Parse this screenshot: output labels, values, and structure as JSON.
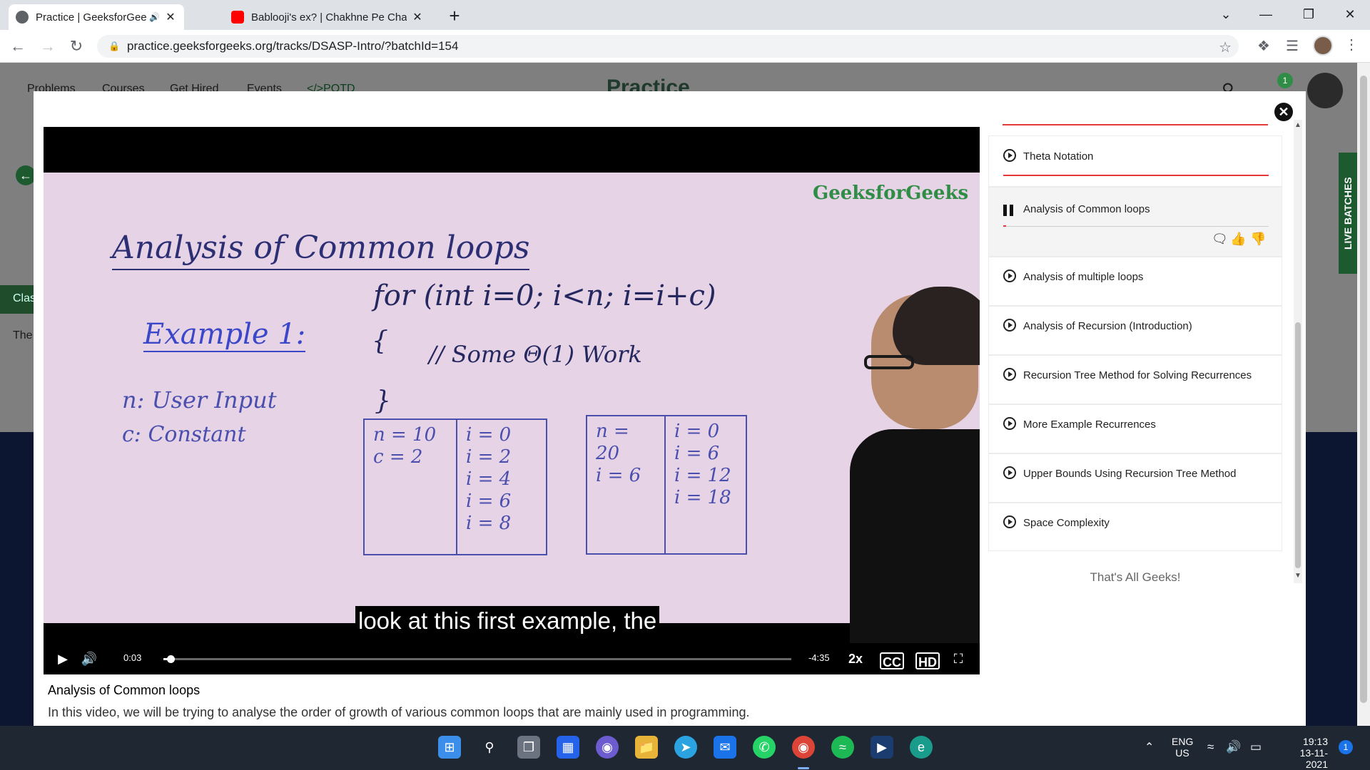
{
  "browser": {
    "tabs": [
      {
        "title": "Practice | GeeksforGeeks | A",
        "active": true
      },
      {
        "title": "Bablooji's ex? | Chakhne Pe Charc",
        "active": false
      }
    ],
    "new_tab_label": "+",
    "url": "practice.geeksforgeeks.org/tracks/DSASP-Intro/?batchId=154"
  },
  "site": {
    "nav": [
      "Problems",
      "Courses",
      "Get Hired",
      "Events",
      "</>POTD"
    ],
    "logo": "Practice",
    "notification_count": "1",
    "background_labels": [
      "Clas",
      "The"
    ],
    "live_batches": "LIVE BATCHES"
  },
  "video": {
    "board": {
      "title": "Analysis of Common loops",
      "example": "Example 1:",
      "n_line": "n: User Input",
      "c_line": "c: Constant",
      "for_line": "for (int i=0; i<n; i=i+c)",
      "brace_open": "{",
      "work": "// Some Θ(1) Work",
      "brace_close": "}",
      "table1": {
        "left": [
          "n = 10",
          "c = 2"
        ],
        "right": [
          "i = 0",
          "i = 2",
          "i = 4",
          "i = 6",
          "i = 8"
        ]
      },
      "table2": {
        "left": [
          "n = 20",
          "i = 6"
        ],
        "right": [
          "i = 0",
          "i = 6",
          "i = 12",
          "i = 18"
        ]
      },
      "watermark": "GeeksforGeeks"
    },
    "caption": "look at this first example, the",
    "elapsed": "0:03",
    "remaining": "-4:35",
    "speed": "2x",
    "cc_label": "CC",
    "hd_label": "HD",
    "progress": 0.011,
    "title": "Analysis of Common loops",
    "description": "In this video, we will be trying to analyse the order of growth of various common loops that are mainly used in programming."
  },
  "playlist": {
    "items": [
      {
        "label": "Theta Notation",
        "state": "normal"
      },
      {
        "label": "Analysis of Common loops",
        "state": "playing"
      },
      {
        "label": "Analysis of multiple loops",
        "state": "normal"
      },
      {
        "label": "Analysis of Recursion (Introduction)",
        "state": "normal"
      },
      {
        "label": "Recursion Tree Method for Solving Recurrences",
        "state": "normal"
      },
      {
        "label": "More Example Recurrences",
        "state": "normal"
      },
      {
        "label": "Upper Bounds Using Recursion Tree Method",
        "state": "normal"
      },
      {
        "label": "Space Complexity",
        "state": "normal"
      }
    ],
    "footer": "That's All Geeks!"
  },
  "taskbar": {
    "language": "ENG",
    "region": "US",
    "time": "19:13",
    "date": "13-11-2021",
    "notification_count": "1"
  },
  "colors": {
    "accent_red": "#e53935",
    "gfg_green": "#2f8d46"
  }
}
